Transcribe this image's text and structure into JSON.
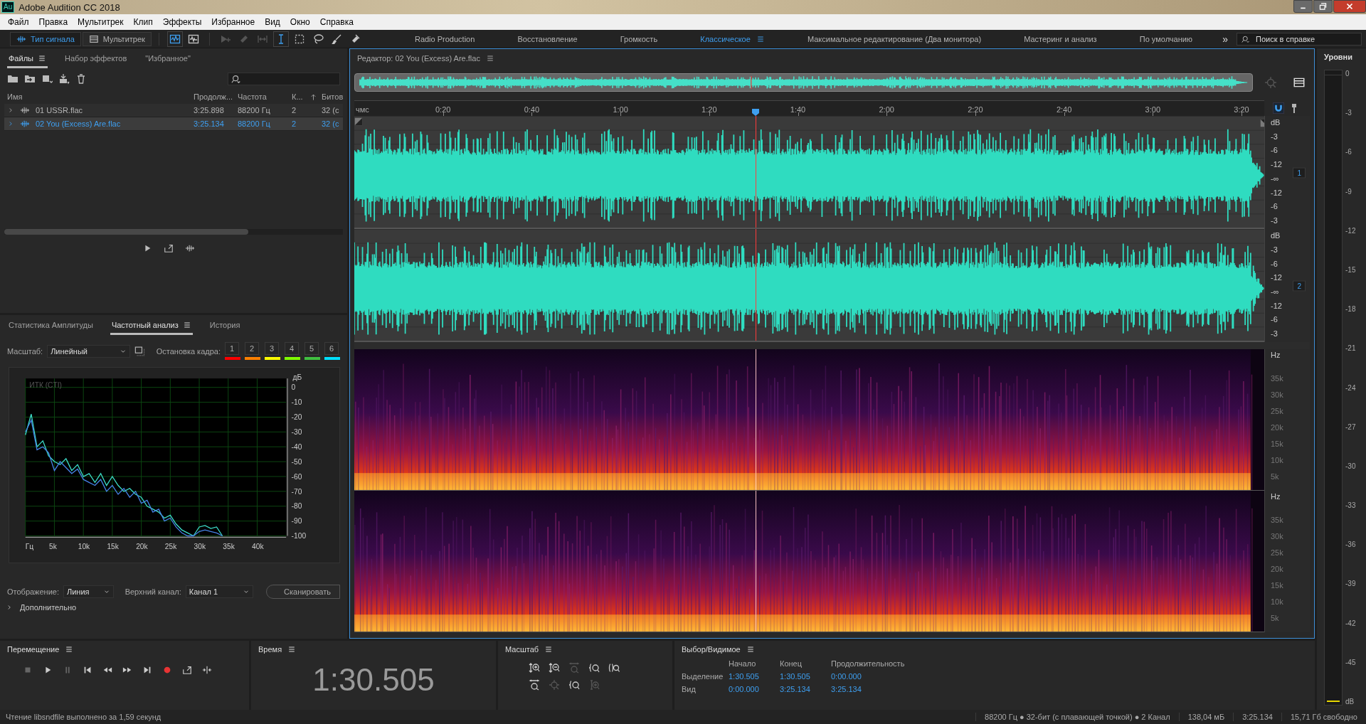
{
  "window": {
    "app_icon": "Au",
    "title": "Adobe Audition CC 2018"
  },
  "menu": [
    "Файл",
    "Правка",
    "Мультитрек",
    "Клип",
    "Эффекты",
    "Избранное",
    "Вид",
    "Окно",
    "Справка"
  ],
  "toolbar": {
    "modes": [
      {
        "label": "Тип сигнала",
        "selected": true
      },
      {
        "label": "Мультитрек",
        "selected": false
      }
    ],
    "workspaces": [
      {
        "label": "Radio Production",
        "selected": false
      },
      {
        "label": "Восстановление",
        "selected": false
      },
      {
        "label": "Громкость",
        "selected": false
      },
      {
        "label": "Классическое",
        "selected": true
      },
      {
        "label": "Максимальное редактирование (Два монитора)",
        "selected": false
      },
      {
        "label": "Мастеринг и анализ",
        "selected": false
      },
      {
        "label": "По умолчанию",
        "selected": false
      }
    ],
    "more": "»",
    "search": {
      "placeholder": "Поиск в справке"
    }
  },
  "files_panel": {
    "tabs": [
      {
        "label": "Файлы",
        "selected": true
      },
      {
        "label": "Набор эффектов",
        "selected": false
      },
      {
        "label": "\"Избранное\"",
        "selected": false
      }
    ],
    "columns": [
      "Имя",
      "Продолж...",
      "Частота",
      "К...",
      "Битов"
    ],
    "rows": [
      {
        "name": "01 USSR.flac",
        "duration": "3:25.898",
        "rate": "88200 Гц",
        "channels": "2",
        "bits": "32 (с",
        "selected": false
      },
      {
        "name": "02 You (Excess) Are.flac",
        "duration": "3:25.134",
        "rate": "88200 Гц",
        "channels": "2",
        "bits": "32 (с",
        "selected": true
      }
    ]
  },
  "analysis_panel": {
    "tabs": [
      {
        "label": "Статистика Амплитуды",
        "selected": false
      },
      {
        "label": "Частотный анализ",
        "selected": true
      },
      {
        "label": "История",
        "selected": false
      }
    ],
    "scale_label": "Масштаб:",
    "scale_value": "Линейный",
    "freeze_label": "Остановка кадра:",
    "freeze_slots": [
      {
        "label": "1",
        "color": "#ff0000"
      },
      {
        "label": "2",
        "color": "#ff8000"
      },
      {
        "label": "3",
        "color": "#ffff00"
      },
      {
        "label": "4",
        "color": "#80ff00"
      },
      {
        "label": "5",
        "color": "#40c040"
      },
      {
        "label": "6",
        "color": "#00e0ff"
      }
    ],
    "chart_data": {
      "type": "line",
      "grid": true,
      "title": "ИТК (CTI)",
      "ylabel": "дБ",
      "xlim": [
        0,
        45000
      ],
      "ylim": [
        -100,
        6
      ],
      "xticks": [
        {
          "value": 0,
          "label": "Гц"
        },
        {
          "value": 5000,
          "label": "5k"
        },
        {
          "value": 10000,
          "label": "10k"
        },
        {
          "value": 15000,
          "label": "15k"
        },
        {
          "value": 20000,
          "label": "20k"
        },
        {
          "value": 25000,
          "label": "25k"
        },
        {
          "value": 30000,
          "label": "30k"
        },
        {
          "value": 35000,
          "label": "35k"
        },
        {
          "value": 40000,
          "label": "40k"
        }
      ],
      "yticks": [
        0,
        -10,
        -20,
        -30,
        -40,
        -50,
        -60,
        -70,
        -80,
        -90,
        -100
      ],
      "x": [
        0,
        1000,
        2000,
        3000,
        4000,
        5000,
        6000,
        7000,
        8000,
        9000,
        10000,
        11000,
        12000,
        13000,
        14000,
        15000,
        16000,
        17000,
        18000,
        19000,
        20000,
        21000,
        22000,
        23000,
        24000,
        25000,
        26000,
        27000,
        28000,
        29000,
        30000,
        31000,
        32000,
        33000,
        34000
      ],
      "series": [
        {
          "color": "#3cdcc8",
          "values": [
            -32,
            -18,
            -40,
            -36,
            -46,
            -50,
            -52,
            -48,
            -56,
            -52,
            -60,
            -58,
            -64,
            -58,
            -66,
            -60,
            -66,
            -70,
            -68,
            -72,
            -74,
            -80,
            -82,
            -84,
            -88,
            -86,
            -92,
            -96,
            -98,
            -100,
            -94,
            -93,
            -95,
            -94,
            -100
          ]
        },
        {
          "color": "#4682e6",
          "values": [
            -30,
            -22,
            -42,
            -40,
            -44,
            -56,
            -50,
            -54,
            -58,
            -55,
            -62,
            -64,
            -66,
            -62,
            -70,
            -66,
            -72,
            -68,
            -74,
            -70,
            -78,
            -76,
            -84,
            -82,
            -90,
            -88,
            -94,
            -98,
            -100,
            -100,
            -97,
            -96,
            -97,
            -98,
            -100
          ]
        }
      ]
    },
    "display_label": "Отображение:",
    "display_value": "Линия",
    "channel_label": "Верхний канал:",
    "channel_value": "Канал 1",
    "scan_button": "Сканировать",
    "advanced": "Дополнительно"
  },
  "editor": {
    "title": "Редактор: 02 You (Excess) Are.flac",
    "ruler": [
      "чмс",
      "0:20",
      "0:40",
      "1:00",
      "1:20",
      "1:40",
      "2:00",
      "2:20",
      "2:40",
      "3:00",
      "3:20"
    ],
    "channels": [
      {
        "label": "1",
        "ticks": [
          "dB",
          "-3",
          "-6",
          "-12",
          "-∞",
          "-12",
          "-6",
          "-3"
        ]
      },
      {
        "label": "2",
        "ticks": [
          "dB",
          "-3",
          "-6",
          "-12",
          "-∞",
          "-12",
          "-6",
          "-3"
        ]
      }
    ],
    "spectra": [
      {
        "ticks": [
          "Hz",
          "35k",
          "30k",
          "25k",
          "20k",
          "15k",
          "10k",
          "5k"
        ]
      },
      {
        "ticks": [
          "Hz",
          "35k",
          "30k",
          "25k",
          "20k",
          "15k",
          "10k",
          "5k"
        ]
      }
    ]
  },
  "levels": {
    "title": "Уровни",
    "ticks": [
      "0",
      "-3",
      "-6",
      "-9",
      "-12",
      "-15",
      "-18",
      "-21",
      "-24",
      "-27",
      "-30",
      "-33",
      "-36",
      "-39",
      "-42",
      "-45",
      "dB"
    ]
  },
  "transport": {
    "title": "Перемещение"
  },
  "time": {
    "title": "Время",
    "value": "1:30.505"
  },
  "zoom": {
    "title": "Масштаб"
  },
  "selection": {
    "title": "Выбор/Видимое",
    "columns": [
      "Начало",
      "Конец",
      "Продолжительность"
    ],
    "rows": [
      {
        "label": "Выделение",
        "values": [
          "1:30.505",
          "1:30.505",
          "0:00.000"
        ]
      },
      {
        "label": "Вид",
        "values": [
          "0:00.000",
          "3:25.134",
          "3:25.134"
        ]
      }
    ]
  },
  "status_bar": {
    "message": "Чтение libsndfile выполнено за 1,59 секунд",
    "items": [
      "88200 Гц ● 32-бит (с плавающей точкой) ● 2 Канал",
      "138,04 мБ",
      "3:25.134",
      "15,71 Гб свободно"
    ]
  }
}
